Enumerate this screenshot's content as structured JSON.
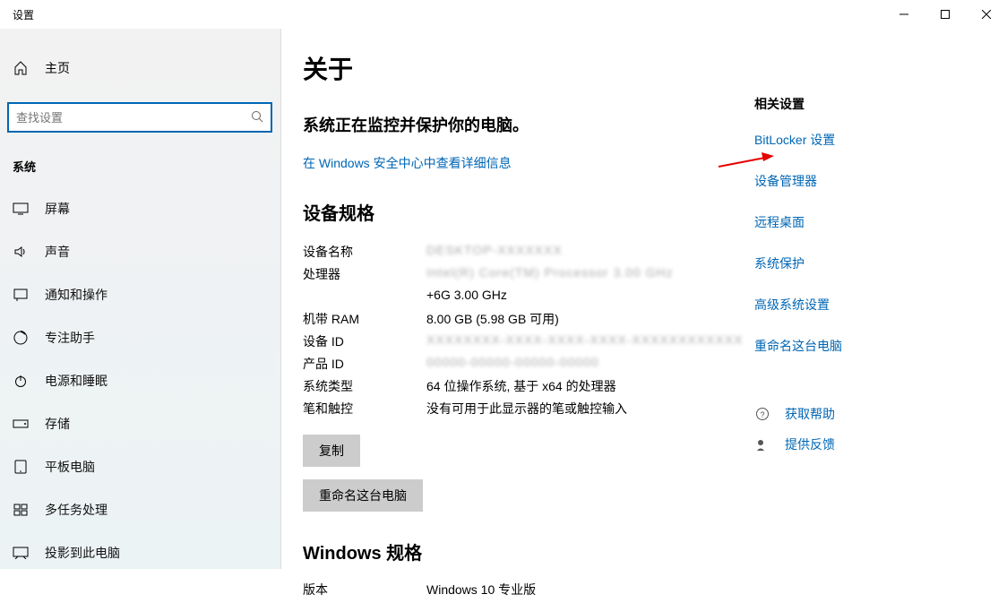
{
  "window_title": "设置",
  "home_label": "主页",
  "search_placeholder": "查找设置",
  "category_label": "系统",
  "nav_items": [
    {
      "label": "屏幕"
    },
    {
      "label": "声音"
    },
    {
      "label": "通知和操作"
    },
    {
      "label": "专注助手"
    },
    {
      "label": "电源和睡眠"
    },
    {
      "label": "存储"
    },
    {
      "label": "平板电脑"
    },
    {
      "label": "多任务处理"
    },
    {
      "label": "投影到此电脑"
    }
  ],
  "page_title": "关于",
  "protect_line": "系统正在监控并保护你的电脑。",
  "security_link": "在 Windows 安全中心中查看详细信息",
  "device_spec_title": "设备规格",
  "specs": {
    "device_name_label": "设备名称",
    "device_name_value": "DESKTOP-XXXXXXX",
    "processor_label": "处理器",
    "processor_value": "Intel(R) Core(TM) Processor 3.00 GHz",
    "processor_value_line2": "+6G    3.00 GHz",
    "ram_label": "机带 RAM",
    "ram_value": "8.00 GB (5.98 GB 可用)",
    "device_id_label": "设备 ID",
    "device_id_value": "XXXXXXXX-XXXX-XXXX-XXXX-XXXXXXXXXXXX",
    "product_id_label": "产品 ID",
    "product_id_value": "00000-00000-00000-00000",
    "system_type_label": "系统类型",
    "system_type_value": "64 位操作系统, 基于 x64 的处理器",
    "pen_touch_label": "笔和触控",
    "pen_touch_value": "没有可用于此显示器的笔或触控输入"
  },
  "copy_button": "复制",
  "rename_button": "重命名这台电脑",
  "windows_spec_title": "Windows 规格",
  "windows_edition_label": "版本",
  "windows_edition_value": "Windows 10 专业版",
  "related_settings_header": "相关设置",
  "related_links": [
    {
      "label": "BitLocker 设置"
    },
    {
      "label": "设备管理器"
    },
    {
      "label": "远程桌面"
    },
    {
      "label": "系统保护"
    },
    {
      "label": "高级系统设置"
    },
    {
      "label": "重命名这台电脑"
    }
  ],
  "help_link": "获取帮助",
  "feedback_link": "提供反馈"
}
